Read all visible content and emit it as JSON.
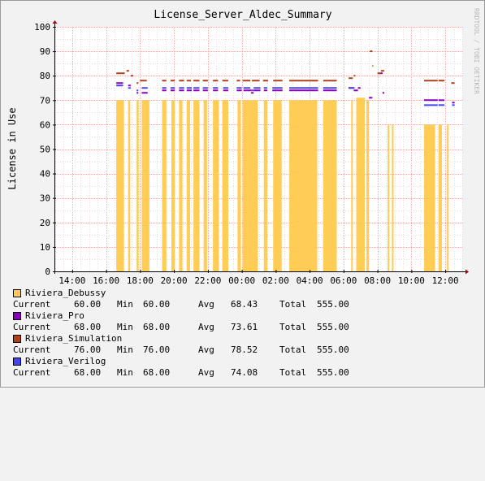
{
  "chart_data": {
    "type": "bar",
    "title": "License_Server_Aldec_Summary",
    "ylabel": "License in Use",
    "watermark": "RRDTOOL / TOBI OETIKER",
    "ylim": [
      0,
      100
    ],
    "yticks": [
      0,
      10,
      20,
      30,
      40,
      50,
      60,
      70,
      80,
      90,
      100
    ],
    "xtick_labels": [
      "14:00",
      "16:00",
      "18:00",
      "20:00",
      "22:00",
      "00:00",
      "02:00",
      "04:00",
      "06:00",
      "08:00",
      "10:00",
      "12:00"
    ],
    "xtick_hours": [
      14,
      16,
      18,
      20,
      22,
      24,
      26,
      28,
      30,
      32,
      34,
      36
    ],
    "xlim_hours": [
      13.0,
      37.0
    ],
    "grid": true,
    "series": [
      {
        "name": "Riviera_Debussy",
        "color": "#ffcc55",
        "style": "area",
        "segments": [
          [
            16.6,
            17.05,
            70
          ],
          [
            17.3,
            17.42,
            70
          ],
          [
            17.8,
            17.92,
            70
          ],
          [
            18.1,
            18.55,
            70
          ],
          [
            19.3,
            19.55,
            70
          ],
          [
            19.85,
            20.05,
            70
          ],
          [
            20.3,
            20.5,
            70
          ],
          [
            20.75,
            20.95,
            70
          ],
          [
            21.15,
            21.5,
            70
          ],
          [
            21.75,
            21.95,
            70
          ],
          [
            22.3,
            22.65,
            70
          ],
          [
            22.85,
            23.2,
            70
          ],
          [
            23.75,
            23.95,
            70
          ],
          [
            24.05,
            24.95,
            70
          ],
          [
            25.3,
            25.5,
            70
          ],
          [
            25.85,
            26.35,
            70
          ],
          [
            26.8,
            28.45,
            70
          ],
          [
            28.8,
            29.6,
            70
          ],
          [
            30.45,
            30.55,
            70
          ],
          [
            30.75,
            31.25,
            71
          ],
          [
            31.35,
            31.5,
            70
          ],
          [
            32.6,
            32.7,
            60
          ],
          [
            32.85,
            32.95,
            60
          ],
          [
            34.75,
            35.4,
            60
          ],
          [
            35.6,
            35.8,
            60
          ],
          [
            36.1,
            36.2,
            60
          ]
        ]
      },
      {
        "name": "Riviera_Pro",
        "color": "#8800bb",
        "style": "line",
        "segments": [
          [
            16.6,
            17.0,
            77
          ],
          [
            17.3,
            17.45,
            76
          ],
          [
            17.8,
            17.9,
            73
          ],
          [
            18.1,
            18.45,
            73
          ],
          [
            19.3,
            19.55,
            74
          ],
          [
            19.8,
            20.05,
            74
          ],
          [
            20.3,
            20.6,
            74
          ],
          [
            20.75,
            21.05,
            74
          ],
          [
            21.15,
            21.5,
            74
          ],
          [
            21.7,
            22.0,
            74
          ],
          [
            22.3,
            22.6,
            74
          ],
          [
            22.9,
            23.2,
            74
          ],
          [
            23.7,
            24.0,
            74
          ],
          [
            24.1,
            24.55,
            74
          ],
          [
            24.55,
            24.7,
            73
          ],
          [
            24.7,
            25.1,
            74
          ],
          [
            25.3,
            25.5,
            74
          ],
          [
            25.8,
            26.4,
            74
          ],
          [
            26.8,
            28.5,
            74
          ],
          [
            28.8,
            29.6,
            74
          ],
          [
            30.3,
            30.6,
            75
          ],
          [
            30.6,
            30.85,
            74
          ],
          [
            30.85,
            31.0,
            75
          ],
          [
            31.5,
            31.7,
            71
          ],
          [
            32.1,
            32.3,
            81
          ],
          [
            32.3,
            32.4,
            73
          ],
          [
            34.75,
            35.55,
            70
          ],
          [
            35.6,
            35.95,
            70
          ],
          [
            36.4,
            36.55,
            69
          ]
        ]
      },
      {
        "name": "Riviera_Simulation",
        "color": "#b04018",
        "style": "line",
        "segments": [
          [
            16.6,
            17.1,
            81
          ],
          [
            17.2,
            17.35,
            82
          ],
          [
            17.45,
            17.6,
            80
          ],
          [
            17.8,
            17.9,
            77
          ],
          [
            18.0,
            18.4,
            78
          ],
          [
            19.3,
            19.55,
            78
          ],
          [
            19.8,
            20.05,
            78
          ],
          [
            20.3,
            20.6,
            78
          ],
          [
            20.75,
            21.0,
            78
          ],
          [
            21.15,
            21.5,
            78
          ],
          [
            21.7,
            22.0,
            78
          ],
          [
            22.3,
            22.6,
            78
          ],
          [
            22.85,
            23.2,
            78
          ],
          [
            23.7,
            23.9,
            78
          ],
          [
            24.05,
            24.5,
            78
          ],
          [
            24.6,
            25.05,
            78
          ],
          [
            25.25,
            25.55,
            78
          ],
          [
            25.85,
            26.4,
            78
          ],
          [
            26.8,
            28.5,
            78
          ],
          [
            28.8,
            29.6,
            78
          ],
          [
            30.3,
            30.55,
            79
          ],
          [
            30.6,
            30.7,
            80
          ],
          [
            31.55,
            31.7,
            90
          ],
          [
            31.7,
            31.75,
            84
          ],
          [
            32.0,
            32.2,
            81
          ],
          [
            32.2,
            32.4,
            82
          ],
          [
            34.75,
            35.55,
            78
          ],
          [
            35.6,
            35.95,
            78
          ],
          [
            36.35,
            36.55,
            77
          ]
        ]
      },
      {
        "name": "Riviera_Verilog",
        "color": "#4444ee",
        "style": "line",
        "segments": [
          [
            16.6,
            17.0,
            76
          ],
          [
            17.3,
            17.45,
            75
          ],
          [
            17.8,
            17.9,
            74
          ],
          [
            18.1,
            18.45,
            75
          ],
          [
            19.3,
            19.55,
            75
          ],
          [
            19.8,
            20.05,
            75
          ],
          [
            20.3,
            20.6,
            75
          ],
          [
            20.75,
            21.05,
            75
          ],
          [
            21.15,
            21.5,
            75
          ],
          [
            21.7,
            22.0,
            75
          ],
          [
            22.3,
            22.6,
            75
          ],
          [
            22.9,
            23.2,
            75
          ],
          [
            23.7,
            24.0,
            75
          ],
          [
            24.1,
            24.5,
            75
          ],
          [
            24.55,
            24.7,
            74
          ],
          [
            24.7,
            25.1,
            75
          ],
          [
            25.3,
            25.5,
            75
          ],
          [
            25.8,
            26.4,
            75
          ],
          [
            26.8,
            28.5,
            75
          ],
          [
            28.8,
            29.6,
            75
          ],
          [
            30.3,
            30.65,
            75
          ],
          [
            34.75,
            35.55,
            68
          ],
          [
            35.6,
            35.95,
            68
          ],
          [
            36.4,
            36.55,
            68
          ]
        ]
      }
    ]
  },
  "legend": {
    "labels": {
      "current": "Current",
      "min": "Min",
      "avg": "Avg",
      "total": "Total"
    },
    "entries": [
      {
        "name": "Riviera_Debussy",
        "color": "#ffcc55",
        "current": "60.00",
        "min": "60.00",
        "avg": "68.43",
        "total": "555.00"
      },
      {
        "name": "Riviera_Pro",
        "color": "#8800bb",
        "current": "68.00",
        "min": "68.00",
        "avg": "73.61",
        "total": "555.00"
      },
      {
        "name": "Riviera_Simulation",
        "color": "#b04018",
        "current": "76.00",
        "min": "76.00",
        "avg": "78.52",
        "total": "555.00"
      },
      {
        "name": "Riviera_Verilog",
        "color": "#4444ee",
        "current": "68.00",
        "min": "68.00",
        "avg": "74.08",
        "total": "555.00"
      }
    ]
  }
}
